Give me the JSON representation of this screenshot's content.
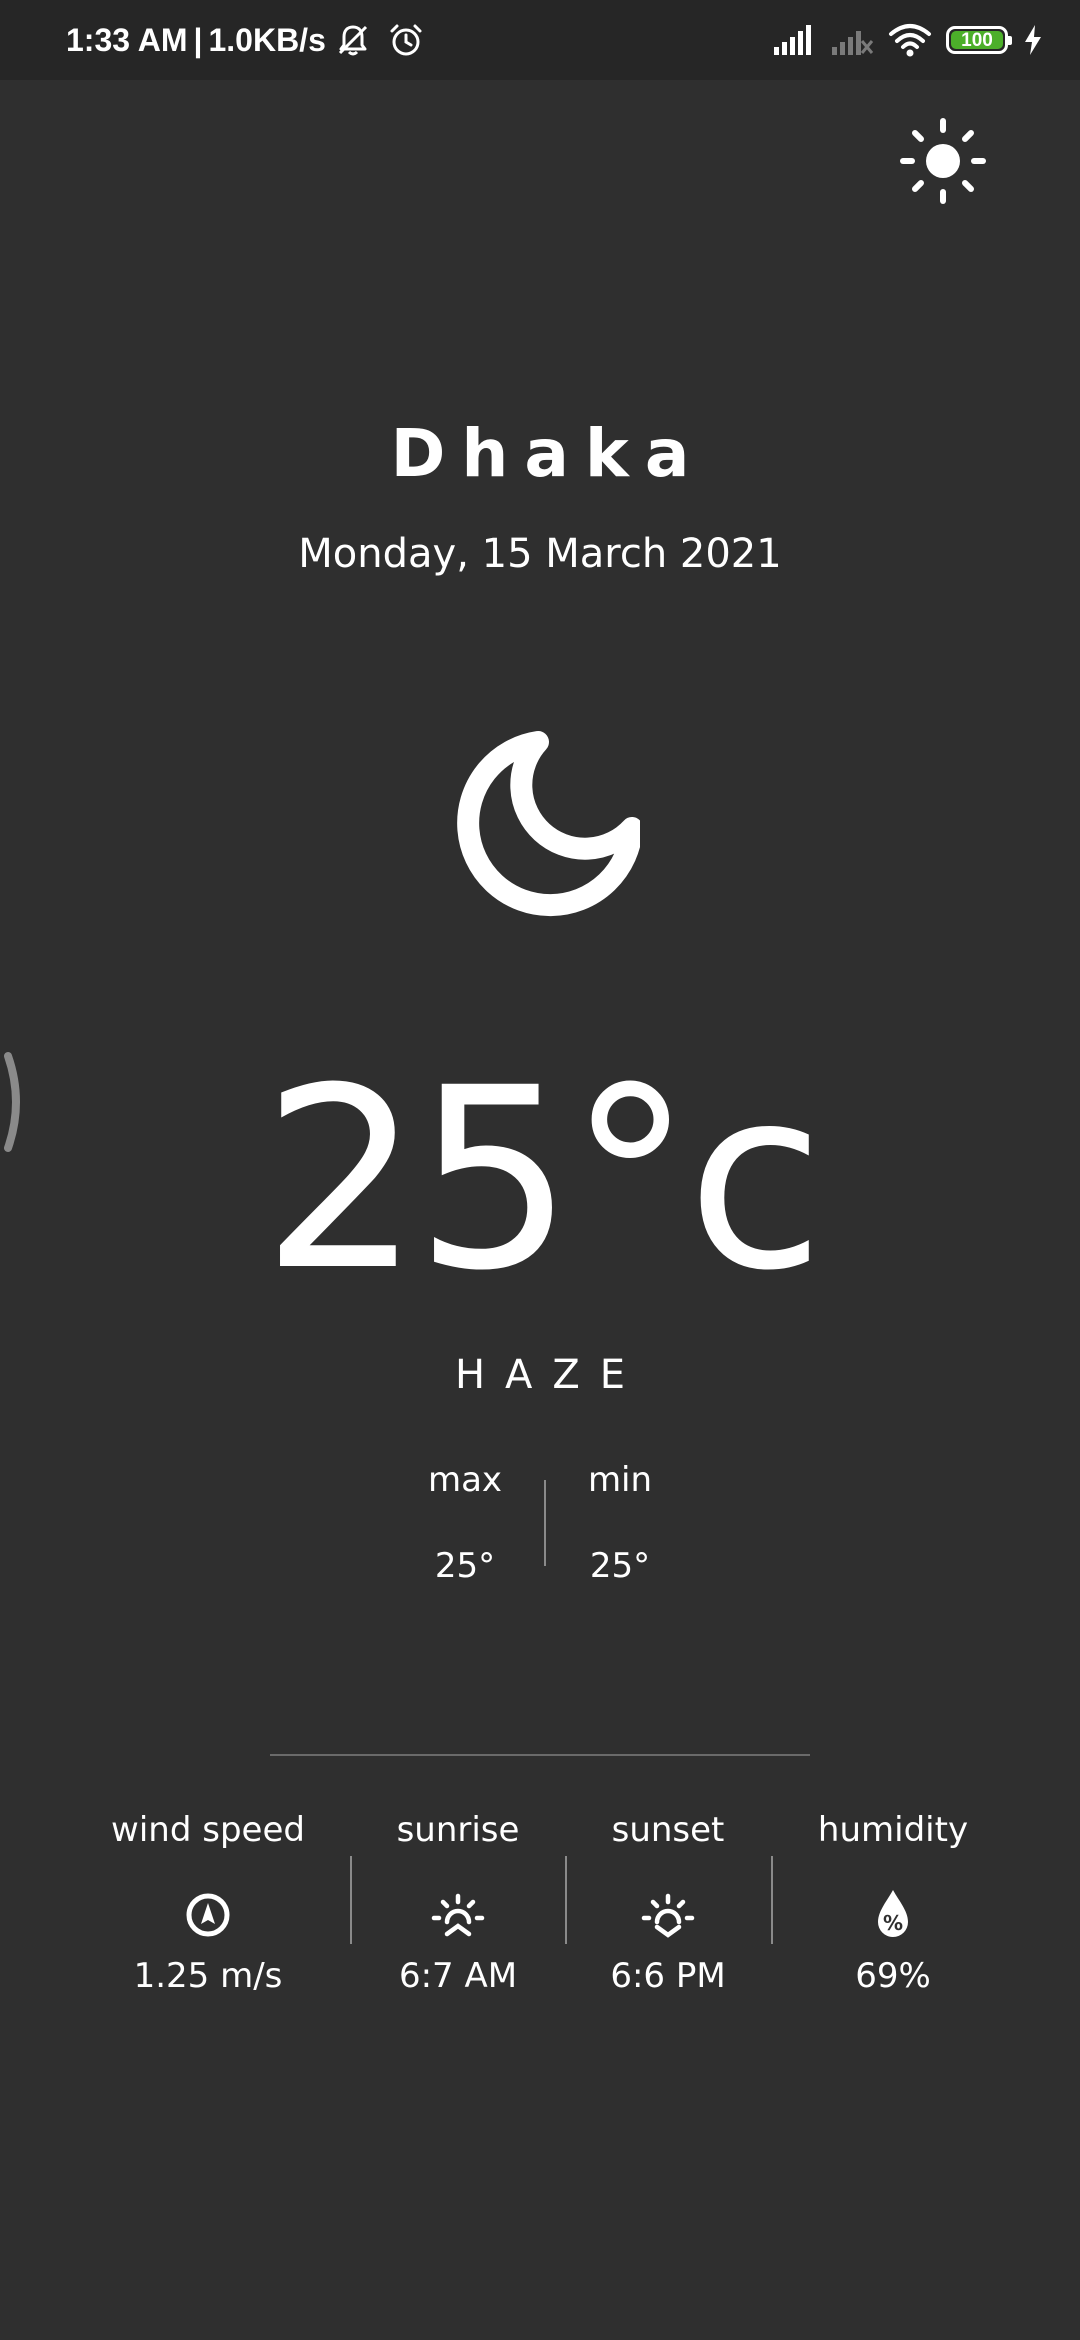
{
  "status_bar": {
    "time": "1:33 AM",
    "separator": "|",
    "network_speed": "1.0KB/s",
    "battery_level": "100",
    "battery_color": "#4caf2a",
    "icons": [
      "muted-bell-icon",
      "alarm-icon",
      "signal-icon",
      "signal-no-sim-icon",
      "wifi-icon",
      "battery-icon",
      "charging-icon"
    ]
  },
  "header": {
    "theme_toggle_icon": "sun-icon"
  },
  "location": {
    "city": "Dhaka",
    "date": "Monday, 15 March 2021"
  },
  "current": {
    "icon": "moon-icon",
    "temperature": "25°c",
    "condition": "HAZE"
  },
  "range": {
    "max_label": "max",
    "max_value": "25°",
    "min_label": "min",
    "min_value": "25°"
  },
  "details": [
    {
      "label": "wind speed",
      "icon": "compass-icon",
      "value": "1.25 m/s"
    },
    {
      "label": "sunrise",
      "icon": "sunrise-icon",
      "value": "6:7 AM"
    },
    {
      "label": "sunset",
      "icon": "sunset-icon",
      "value": "6:6 PM"
    },
    {
      "label": "humidity",
      "icon": "humidity-drop-icon",
      "value": "69%"
    }
  ],
  "colors": {
    "background": "#2f2f2f",
    "status_bar": "#262626",
    "text": "#ffffff",
    "divider": "#8a8a8a"
  }
}
